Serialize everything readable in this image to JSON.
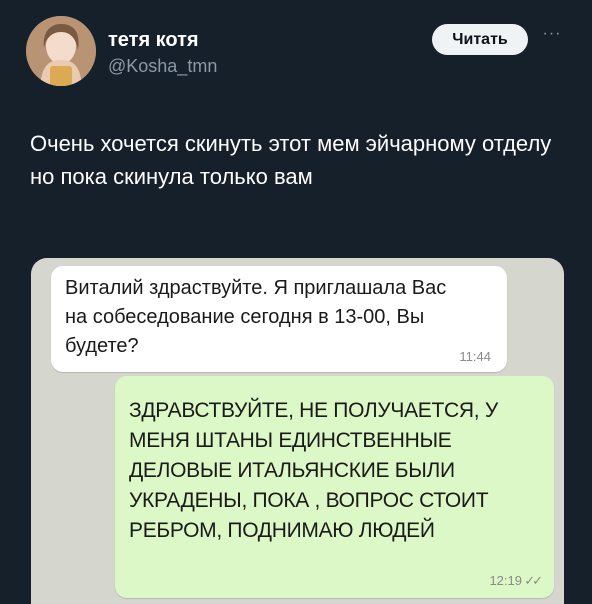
{
  "tweet": {
    "author": {
      "display_name": "тетя котя",
      "handle": "@Kosha_tmn"
    },
    "read_button_label": "Читать",
    "more_icon": "more-dots-icon",
    "text": "Очень хочется скинуть этот мем эйчарному отделу но пока скинула только вам"
  },
  "media": {
    "incoming_message": {
      "text": "Виталий здраствуйте. Я приглашала Вас на собеседование сегодня в 13-00, Вы будете?",
      "time": "11:44"
    },
    "outgoing_message": {
      "text": "ЗДРАВСТВУЙТЕ, НЕ ПОЛУЧАЕТСЯ, У МЕНЯ ШТАНЫ ЕДИНСТВЕННЫЕ ДЕЛОВЫЕ ИТАЛЬЯНСКИЕ БЫЛИ УКРАДЕНЫ, ПОКА , ВОПРОС СТОИТ РЕБРОМ, ПОДНИМАЮ ЛЮДЕЙ",
      "time": "12:19",
      "status_icon": "double-check-icon"
    }
  },
  "colors": {
    "background": "#15202b",
    "secondary_text": "#8b98a5",
    "outgoing_bubble": "#dcf8c6",
    "incoming_bubble": "#ffffff"
  }
}
